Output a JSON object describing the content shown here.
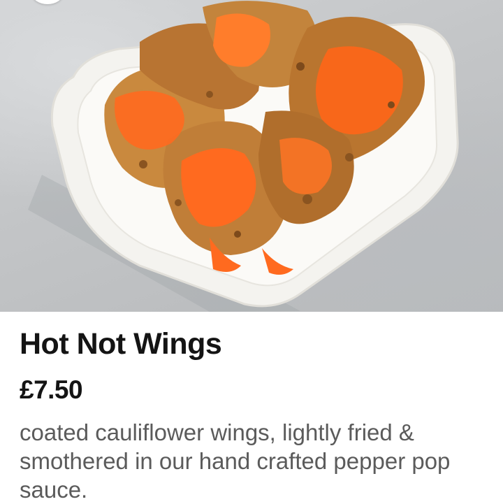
{
  "item": {
    "name": "Hot Not Wings",
    "price": "£7.50",
    "description": "coated cauliflower wings, lightly fried & smothered in our hand crafted pepper pop sauce."
  },
  "photo": {
    "subject": "cauliflower wings with orange sauce in white tray"
  },
  "colors": {
    "title": "#141414",
    "description": "#5b5b5b",
    "background": "#ffffff",
    "sauce": "#ff6a1f"
  }
}
